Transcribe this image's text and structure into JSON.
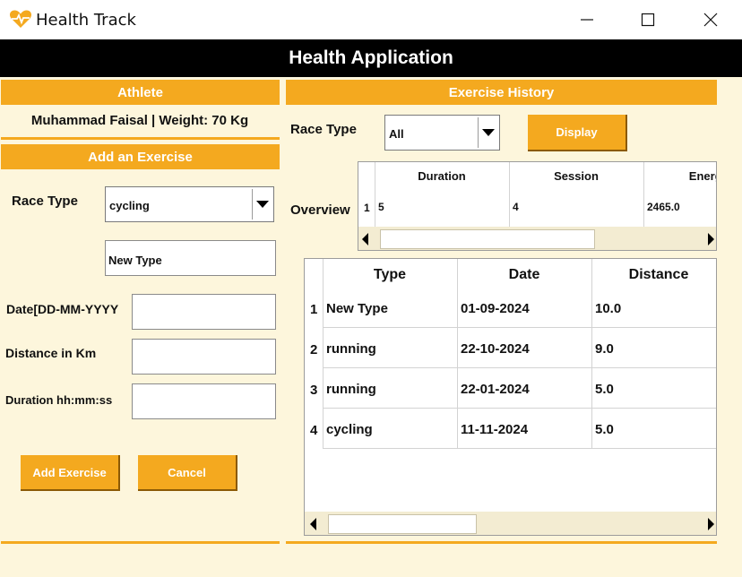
{
  "window": {
    "title": "Health Track",
    "icon": "heart-pulse-icon"
  },
  "header": {
    "title": "Health Application"
  },
  "left": {
    "athlete_heading": "Athlete",
    "athlete_info": "Muhammad Faisal | Weight: 70 Kg",
    "add_heading": "Add an Exercise",
    "race_type_label": "Race Type",
    "race_type_value": "cycling",
    "new_type_value": "New Type",
    "date_label": "Date[DD-MM-YYYY",
    "distance_label": "Distance in Km",
    "duration_label": "Duration hh:mm:ss",
    "date_value": "",
    "distance_value": "",
    "duration_value": "",
    "add_button": "Add Exercise",
    "cancel_button": "Cancel"
  },
  "right": {
    "history_heading": "Exercise History",
    "race_type_label": "Race Type",
    "race_type_value": "All",
    "display_button": "Display",
    "overview_label": "Overview",
    "overview": {
      "columns": [
        "Duration",
        "Session",
        "Energy("
      ],
      "rows": [
        {
          "index": "1",
          "cells": [
            "5",
            "4",
            "2465.0"
          ]
        }
      ]
    },
    "history": {
      "columns": [
        "Type",
        "Date",
        "Distance"
      ],
      "rows": [
        {
          "index": "1",
          "cells": [
            "New Type",
            "01-09-2024",
            "10.0"
          ]
        },
        {
          "index": "2",
          "cells": [
            "running",
            "22-10-2024",
            "9.0"
          ]
        },
        {
          "index": "3",
          "cells": [
            "running",
            "22-01-2024",
            "5.0"
          ]
        },
        {
          "index": "4",
          "cells": [
            "cycling",
            "11-11-2024",
            "5.0"
          ]
        }
      ]
    }
  },
  "colors": {
    "accent": "#f4a91f",
    "background": "#fdf6dc",
    "header": "#000000"
  }
}
